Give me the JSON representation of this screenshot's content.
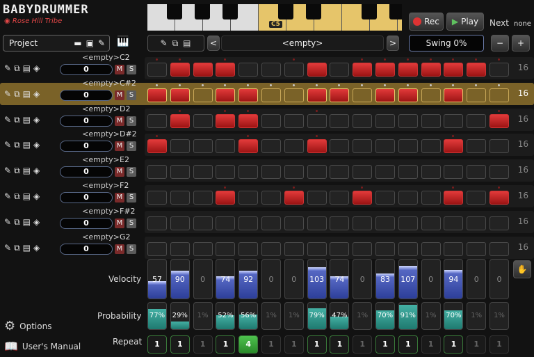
{
  "app": {
    "title": "BABYDRUMMER",
    "brand": "Rose Hill Tribe"
  },
  "keyboard": {
    "octave_label": "C5"
  },
  "transport": {
    "rec_label": "Rec",
    "play_label": "Play",
    "next_label": "Next",
    "next_value": "none"
  },
  "project": {
    "label": "Project"
  },
  "pattern": {
    "name": "<empty>",
    "swing": "Swing 0%",
    "minus": "−",
    "plus": "+"
  },
  "colors": {
    "accent_red": "#c62828",
    "selected_row": "#7a6228",
    "velocity": "#3f51b5",
    "probability": "#2a9d8f",
    "repeat": "#3fa33f"
  },
  "tracks": [
    {
      "name": "<empty>",
      "note": "C2",
      "value": "0",
      "length": "16",
      "selected": false,
      "steps": [
        0,
        1,
        1,
        1,
        0,
        0,
        0,
        1,
        0,
        1,
        1,
        1,
        1,
        1,
        1,
        0
      ],
      "dots": [
        1,
        1,
        0,
        1,
        0,
        0,
        1,
        0,
        0,
        1,
        1,
        1,
        1,
        1,
        1,
        1
      ]
    },
    {
      "name": "<empty>",
      "note": "C#2",
      "value": "0",
      "length": "16",
      "selected": true,
      "steps": [
        1,
        1,
        0,
        1,
        1,
        0,
        0,
        1,
        1,
        0,
        1,
        1,
        0,
        1,
        0,
        0
      ],
      "dots": [
        1,
        1,
        1,
        1,
        1,
        1,
        1,
        1,
        1,
        1,
        1,
        1,
        1,
        1,
        1,
        1
      ]
    },
    {
      "name": "<empty>",
      "note": "D2",
      "value": "0",
      "length": "16",
      "selected": false,
      "steps": [
        0,
        1,
        0,
        1,
        1,
        0,
        0,
        0,
        0,
        0,
        0,
        0,
        0,
        0,
        0,
        1
      ],
      "dots": [
        0,
        1,
        0,
        1,
        1,
        0,
        0,
        1,
        0,
        0,
        0,
        0,
        0,
        0,
        0,
        1
      ]
    },
    {
      "name": "<empty>",
      "note": "D#2",
      "value": "0",
      "length": "16",
      "selected": false,
      "steps": [
        1,
        0,
        0,
        0,
        1,
        0,
        0,
        1,
        0,
        0,
        0,
        0,
        0,
        1,
        0,
        0
      ],
      "dots": [
        1,
        0,
        0,
        0,
        1,
        0,
        0,
        1,
        0,
        0,
        0,
        0,
        0,
        1,
        0,
        0
      ]
    },
    {
      "name": "<empty>",
      "note": "E2",
      "value": "0",
      "length": "16",
      "selected": false,
      "steps": [
        0,
        0,
        0,
        0,
        0,
        0,
        0,
        0,
        0,
        0,
        0,
        0,
        0,
        0,
        0,
        0
      ],
      "dots": [
        0,
        0,
        0,
        0,
        0,
        0,
        0,
        0,
        0,
        0,
        0,
        0,
        0,
        0,
        0,
        0
      ]
    },
    {
      "name": "<empty>",
      "note": "F2",
      "value": "0",
      "length": "16",
      "selected": false,
      "steps": [
        0,
        0,
        0,
        1,
        0,
        0,
        1,
        0,
        0,
        1,
        0,
        0,
        0,
        1,
        0,
        1
      ],
      "dots": [
        0,
        0,
        0,
        1,
        0,
        0,
        1,
        0,
        0,
        1,
        0,
        0,
        0,
        1,
        0,
        1
      ]
    },
    {
      "name": "<empty>",
      "note": "F#2",
      "value": "0",
      "length": "16",
      "selected": false,
      "steps": [
        0,
        0,
        0,
        0,
        0,
        0,
        0,
        0,
        0,
        0,
        0,
        0,
        0,
        0,
        0,
        0
      ],
      "dots": [
        0,
        0,
        0,
        0,
        0,
        0,
        0,
        0,
        0,
        0,
        0,
        0,
        0,
        0,
        0,
        0
      ]
    },
    {
      "name": "<empty>",
      "note": "G2",
      "value": "0",
      "length": "16",
      "selected": false,
      "steps": [
        0,
        0,
        0,
        0,
        0,
        0,
        0,
        0,
        0,
        0,
        0,
        0,
        0,
        0,
        0,
        0
      ],
      "dots": [
        0,
        0,
        0,
        0,
        0,
        0,
        0,
        0,
        0,
        0,
        0,
        0,
        0,
        0,
        0,
        0
      ]
    }
  ],
  "velocity": {
    "label": "Velocity",
    "values": [
      "57",
      "90",
      "0",
      "74",
      "92",
      "0",
      "0",
      "103",
      "74",
      "0",
      "83",
      "107",
      "0",
      "94",
      "0",
      "0"
    ],
    "levels": [
      57,
      90,
      0,
      74,
      92,
      0,
      0,
      103,
      74,
      0,
      83,
      107,
      0,
      94,
      0,
      0
    ],
    "max": 127
  },
  "probability": {
    "label": "Probability",
    "values": [
      "77%",
      "29%",
      "1%",
      "52%",
      "56%",
      "1%",
      "1%",
      "79%",
      "47%",
      "1%",
      "70%",
      "91%",
      "1%",
      "70%",
      "1%",
      "1%"
    ],
    "active": [
      1,
      1,
      0,
      1,
      1,
      0,
      0,
      1,
      1,
      0,
      1,
      1,
      0,
      1,
      0,
      0
    ]
  },
  "repeat": {
    "label": "Repeat",
    "values": [
      "1",
      "1",
      "1",
      "1",
      "4",
      "1",
      "1",
      "1",
      "1",
      "1",
      "1",
      "1",
      "1",
      "1",
      "1",
      "1"
    ],
    "active": [
      1,
      1,
      0,
      1,
      1,
      0,
      0,
      1,
      1,
      0,
      1,
      1,
      0,
      1,
      0,
      0
    ]
  },
  "bottom": {
    "options": "Options",
    "manual": "User's Manual"
  }
}
